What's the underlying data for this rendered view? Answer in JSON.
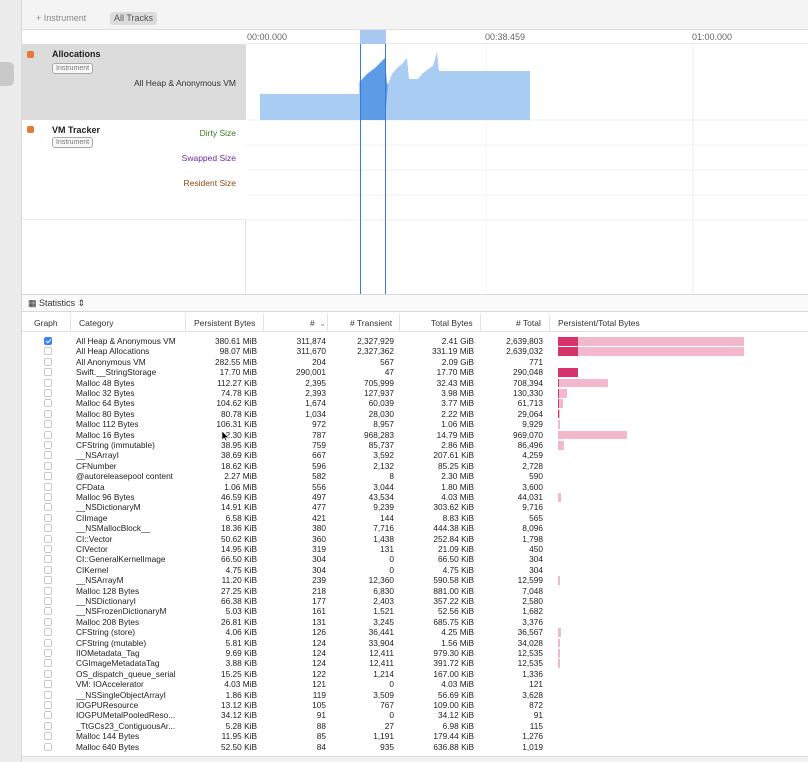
{
  "toolbar": {
    "add_instrument": "+ Instrument",
    "all_tracks": "All Tracks"
  },
  "ruler": {
    "ticks": [
      "00:00.000",
      "00:38.459",
      "01:00.000"
    ]
  },
  "tracks": {
    "allocations": {
      "name": "Allocations",
      "badge": "Instrument",
      "sub": "All Heap & Anonymous VM"
    },
    "vm_tracker": {
      "name": "VM Tracker",
      "badge": "Instrument",
      "subs": [
        "Dirty Size",
        "Swapped Size",
        "Resident Size"
      ]
    }
  },
  "stats": {
    "label": "Statistics"
  },
  "columns": [
    "Graph",
    "Category",
    "Persistent Bytes",
    "#",
    "# Transient",
    "Total Bytes",
    "# Total",
    "Persistent/Total Bytes"
  ],
  "rows": [
    {
      "checked": true,
      "category": "All Heap & Anonymous VM",
      "persistent_bytes": "380.61 MiB",
      "count": "311,874",
      "transient": "2,327,929",
      "total_bytes": "2.41 GiB",
      "total": "2,639,803",
      "persistent_frac": 0.11,
      "total_frac": 1.0
    },
    {
      "checked": false,
      "category": "All Heap Allocations",
      "persistent_bytes": "98.07 MiB",
      "count": "311,670",
      "transient": "2,327,362",
      "total_bytes": "331.19 MiB",
      "total": "2,639,032",
      "persistent_frac": 0.11,
      "total_frac": 1.0
    },
    {
      "checked": false,
      "category": "All Anonymous VM",
      "persistent_bytes": "282.55 MiB",
      "count": "204",
      "transient": "567",
      "total_bytes": "2.09 GiB",
      "total": "771",
      "persistent_frac": 0,
      "total_frac": 0
    },
    {
      "checked": false,
      "category": "Swift.__StringStorage",
      "persistent_bytes": "17.70 MiB",
      "count": "290,001",
      "transient": "47",
      "total_bytes": "17.70 MiB",
      "total": "290,048",
      "persistent_frac": 0.11,
      "total_frac": 0.11
    },
    {
      "checked": false,
      "category": "Malloc 48 Bytes",
      "persistent_bytes": "112.27 KiB",
      "count": "2,395",
      "transient": "705,999",
      "total_bytes": "32.43 MiB",
      "total": "708,394",
      "persistent_frac": 0.005,
      "total_frac": 0.27
    },
    {
      "checked": false,
      "category": "Malloc 32 Bytes",
      "persistent_bytes": "74.78 KiB",
      "count": "2,393",
      "transient": "127,937",
      "total_bytes": "3.98 MiB",
      "total": "130,330",
      "persistent_frac": 0.004,
      "total_frac": 0.05
    },
    {
      "checked": false,
      "category": "Malloc 64 Bytes",
      "persistent_bytes": "104.62 KiB",
      "count": "1,674",
      "transient": "60,039",
      "total_bytes": "3.77 MiB",
      "total": "61,713",
      "persistent_frac": 0.003,
      "total_frac": 0.025
    },
    {
      "checked": false,
      "category": "Malloc 80 Bytes",
      "persistent_bytes": "80.78 KiB",
      "count": "1,034",
      "transient": "28,030",
      "total_bytes": "2.22 MiB",
      "total": "29,064",
      "persistent_frac": 0.002,
      "total_frac": 0.012
    },
    {
      "checked": false,
      "category": "Malloc 112 Bytes",
      "persistent_bytes": "106.31 KiB",
      "count": "972",
      "transient": "8,957",
      "total_bytes": "1.06 MiB",
      "total": "9,929",
      "persistent_frac": 0,
      "total_frac": 0.004
    },
    {
      "checked": false,
      "category": "Malloc 16 Bytes",
      "persistent_bytes": "12.30 KiB",
      "count": "787",
      "transient": "968,283",
      "total_bytes": "14.79 MiB",
      "total": "969,070",
      "persistent_frac": 0,
      "total_frac": 0.37
    },
    {
      "checked": false,
      "category": "CFString (immutable)",
      "persistent_bytes": "38.95 KiB",
      "count": "759",
      "transient": "85,737",
      "total_bytes": "2.86 MiB",
      "total": "86,496",
      "persistent_frac": 0,
      "total_frac": 0.03
    },
    {
      "checked": false,
      "category": "__NSArrayI",
      "persistent_bytes": "38.69 KiB",
      "count": "667",
      "transient": "3,592",
      "total_bytes": "207.61 KiB",
      "total": "4,259",
      "persistent_frac": 0,
      "total_frac": 0
    },
    {
      "checked": false,
      "category": "CFNumber",
      "persistent_bytes": "18.62 KiB",
      "count": "596",
      "transient": "2,132",
      "total_bytes": "85.25 KiB",
      "total": "2,728",
      "persistent_frac": 0,
      "total_frac": 0
    },
    {
      "checked": false,
      "category": "@autoreleasepool content",
      "persistent_bytes": "2.27 MiB",
      "count": "582",
      "transient": "8",
      "total_bytes": "2.30 MiB",
      "total": "590",
      "persistent_frac": 0,
      "total_frac": 0
    },
    {
      "checked": false,
      "category": "CFData",
      "persistent_bytes": "1.06 MiB",
      "count": "556",
      "transient": "3,044",
      "total_bytes": "1.80 MiB",
      "total": "3,600",
      "persistent_frac": 0,
      "total_frac": 0
    },
    {
      "checked": false,
      "category": "Malloc 96 Bytes",
      "persistent_bytes": "46.59 KiB",
      "count": "497",
      "transient": "43,534",
      "total_bytes": "4.03 MiB",
      "total": "44,031",
      "persistent_frac": 0,
      "total_frac": 0.017
    },
    {
      "checked": false,
      "category": "__NSDictionaryM",
      "persistent_bytes": "14.91 KiB",
      "count": "477",
      "transient": "9,239",
      "total_bytes": "303.62 KiB",
      "total": "9,716",
      "persistent_frac": 0,
      "total_frac": 0
    },
    {
      "checked": false,
      "category": "CIImage",
      "persistent_bytes": "6.58 KiB",
      "count": "421",
      "transient": "144",
      "total_bytes": "8.83 KiB",
      "total": "565",
      "persistent_frac": 0,
      "total_frac": 0
    },
    {
      "checked": false,
      "category": "__NSMallocBlock__",
      "persistent_bytes": "18.36 KiB",
      "count": "380",
      "transient": "7,716",
      "total_bytes": "444.38 KiB",
      "total": "8,096",
      "persistent_frac": 0,
      "total_frac": 0
    },
    {
      "checked": false,
      "category": "CI::Vector",
      "persistent_bytes": "50.62 KiB",
      "count": "360",
      "transient": "1,438",
      "total_bytes": "252.84 KiB",
      "total": "1,798",
      "persistent_frac": 0,
      "total_frac": 0
    },
    {
      "checked": false,
      "category": "CIVector",
      "persistent_bytes": "14.95 KiB",
      "count": "319",
      "transient": "131",
      "total_bytes": "21.09 KiB",
      "total": "450",
      "persistent_frac": 0,
      "total_frac": 0
    },
    {
      "checked": false,
      "category": "CI::GeneralKernelImage",
      "persistent_bytes": "66.50 KiB",
      "count": "304",
      "transient": "0",
      "total_bytes": "66.50 KiB",
      "total": "304",
      "persistent_frac": 0,
      "total_frac": 0
    },
    {
      "checked": false,
      "category": "CIKernel",
      "persistent_bytes": "4.75 KiB",
      "count": "304",
      "transient": "0",
      "total_bytes": "4.75 KiB",
      "total": "304",
      "persistent_frac": 0,
      "total_frac": 0
    },
    {
      "checked": false,
      "category": "__NSArrayM",
      "persistent_bytes": "11.20 KiB",
      "count": "239",
      "transient": "12,360",
      "total_bytes": "590.58 KiB",
      "total": "12,599",
      "persistent_frac": 0,
      "total_frac": 0.005
    },
    {
      "checked": false,
      "category": "Malloc 128 Bytes",
      "persistent_bytes": "27.25 KiB",
      "count": "218",
      "transient": "6,830",
      "total_bytes": "881.00 KiB",
      "total": "7,048",
      "persistent_frac": 0,
      "total_frac": 0
    },
    {
      "checked": false,
      "category": "__NSDictionaryI",
      "persistent_bytes": "66.38 KiB",
      "count": "177",
      "transient": "2,403",
      "total_bytes": "357.22 KiB",
      "total": "2,580",
      "persistent_frac": 0,
      "total_frac": 0
    },
    {
      "checked": false,
      "category": "__NSFrozenDictionaryM",
      "persistent_bytes": "5.03 KiB",
      "count": "161",
      "transient": "1,521",
      "total_bytes": "52.56 KiB",
      "total": "1,682",
      "persistent_frac": 0,
      "total_frac": 0
    },
    {
      "checked": false,
      "category": "Malloc 208 Bytes",
      "persistent_bytes": "26.81 KiB",
      "count": "131",
      "transient": "3,245",
      "total_bytes": "685.75 KiB",
      "total": "3,376",
      "persistent_frac": 0,
      "total_frac": 0
    },
    {
      "checked": false,
      "category": "CFString (store)",
      "persistent_bytes": "4.06 KiB",
      "count": "126",
      "transient": "36,441",
      "total_bytes": "4.25 MiB",
      "total": "36,567",
      "persistent_frac": 0,
      "total_frac": 0.014
    },
    {
      "checked": false,
      "category": "CFString (mutable)",
      "persistent_bytes": "5.81 KiB",
      "count": "124",
      "transient": "33,904",
      "total_bytes": "1.56 MiB",
      "total": "34,028",
      "persistent_frac": 0,
      "total_frac": 0.013
    },
    {
      "checked": false,
      "category": "IIOMetadata_Tag",
      "persistent_bytes": "9.69 KiB",
      "count": "124",
      "transient": "12,411",
      "total_bytes": "979.30 KiB",
      "total": "12,535",
      "persistent_frac": 0,
      "total_frac": 0.005
    },
    {
      "checked": false,
      "category": "CGImageMetadataTag",
      "persistent_bytes": "3.88 KiB",
      "count": "124",
      "transient": "12,411",
      "total_bytes": "391.72 KiB",
      "total": "12,535",
      "persistent_frac": 0,
      "total_frac": 0.005
    },
    {
      "checked": false,
      "category": "OS_dispatch_queue_serial",
      "persistent_bytes": "15.25 KiB",
      "count": "122",
      "transient": "1,214",
      "total_bytes": "167.00 KiB",
      "total": "1,336",
      "persistent_frac": 0,
      "total_frac": 0
    },
    {
      "checked": false,
      "category": "VM: IOAccelerator",
      "persistent_bytes": "4.03 MiB",
      "count": "121",
      "transient": "0",
      "total_bytes": "4.03 MiB",
      "total": "121",
      "persistent_frac": 0,
      "total_frac": 0
    },
    {
      "checked": false,
      "category": "__NSSingleObjectArrayI",
      "persistent_bytes": "1.86 KiB",
      "count": "119",
      "transient": "3,509",
      "total_bytes": "56.69 KiB",
      "total": "3,628",
      "persistent_frac": 0,
      "total_frac": 0
    },
    {
      "checked": false,
      "category": "IOGPUResource",
      "persistent_bytes": "13.12 KiB",
      "count": "105",
      "transient": "767",
      "total_bytes": "109.00 KiB",
      "total": "872",
      "persistent_frac": 0,
      "total_frac": 0
    },
    {
      "checked": false,
      "category": "IOGPUMetalPooledReso...",
      "persistent_bytes": "34.12 KiB",
      "count": "91",
      "transient": "0",
      "total_bytes": "34.12 KiB",
      "total": "91",
      "persistent_frac": 0,
      "total_frac": 0
    },
    {
      "checked": false,
      "category": "_TtGCs23_ContiguousAr...",
      "persistent_bytes": "5.28 KiB",
      "count": "88",
      "transient": "27",
      "total_bytes": "6.98 KiB",
      "total": "115",
      "persistent_frac": 0,
      "total_frac": 0
    },
    {
      "checked": false,
      "category": "Malloc 144 Bytes",
      "persistent_bytes": "11.95 KiB",
      "count": "85",
      "transient": "1,191",
      "total_bytes": "179.44 KiB",
      "total": "1,276",
      "persistent_frac": 0,
      "total_frac": 0
    },
    {
      "checked": false,
      "category": "Malloc 640 Bytes",
      "persistent_bytes": "52.50 KiB",
      "count": "84",
      "transient": "935",
      "total_bytes": "636.88 KiB",
      "total": "1,019",
      "persistent_frac": 0,
      "total_frac": 0
    }
  ],
  "colors": {
    "accent": "#3a82f7",
    "graph_fill": "#a9ccf2",
    "graph_sel": "#5c9be6",
    "bar_persistent": "#d6336c",
    "bar_total": "#f1b9cb",
    "track_icon": "#e8783a"
  }
}
